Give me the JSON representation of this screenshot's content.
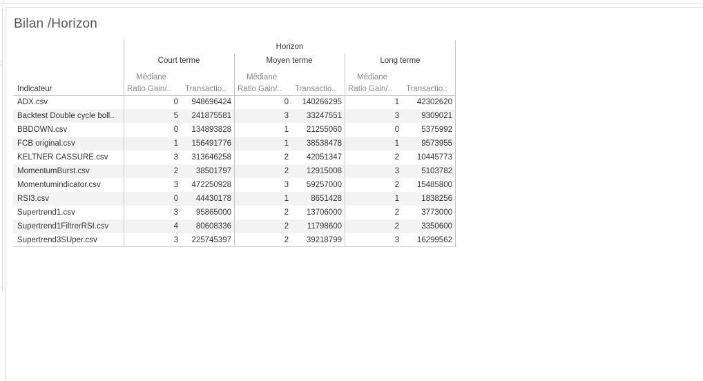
{
  "sheet": {
    "title": "Bilan /Horizon"
  },
  "table": {
    "column_group_title": "Horizon",
    "row_header": "Indicateur",
    "horizons": [
      "Court terme",
      "Moyen terme",
      "Long terme"
    ],
    "measure_prefix": "Médiane",
    "measure_labels": [
      "Ratio Gain/..",
      "Transactio.."
    ],
    "rows": [
      {
        "indicateur": "ADX.csv",
        "values": [
          "0",
          "948696424",
          "0",
          "140266295",
          "1",
          "42302620"
        ]
      },
      {
        "indicateur": "Backtest Double cycle boll..",
        "values": [
          "5",
          "241875581",
          "3",
          "33247551",
          "3",
          "9309021"
        ]
      },
      {
        "indicateur": "BBDOWN.csv",
        "values": [
          "0",
          "134893828",
          "1",
          "21255060",
          "0",
          "5375992"
        ]
      },
      {
        "indicateur": "FCB original.csv",
        "values": [
          "1",
          "156491776",
          "1",
          "38538478",
          "1",
          "9573955"
        ]
      },
      {
        "indicateur": "KELTNER CASSURE.csv",
        "values": [
          "3",
          "313646258",
          "2",
          "42051347",
          "2",
          "10445773"
        ]
      },
      {
        "indicateur": "MomentumBurst.csv",
        "values": [
          "2",
          "38501797",
          "2",
          "12915008",
          "3",
          "5103782"
        ]
      },
      {
        "indicateur": "Momentumindicator.csv",
        "values": [
          "3",
          "472250928",
          "3",
          "59257000",
          "2",
          "15485800"
        ]
      },
      {
        "indicateur": "RSI3.csv",
        "values": [
          "0",
          "44430178",
          "1",
          "8651428",
          "1",
          "1838256"
        ]
      },
      {
        "indicateur": "Supertrend1.csv",
        "values": [
          "3",
          "95865000",
          "2",
          "13706000",
          "2",
          "3773000"
        ]
      },
      {
        "indicateur": "Supertrend1FiltrerRSI.csv",
        "values": [
          "4",
          "80608336",
          "2",
          "11798600",
          "2",
          "3350600"
        ]
      },
      {
        "indicateur": "Supertrend3SUper.csv",
        "values": [
          "3",
          "225745397",
          "2",
          "39218799",
          "3",
          "16299562"
        ]
      }
    ]
  }
}
